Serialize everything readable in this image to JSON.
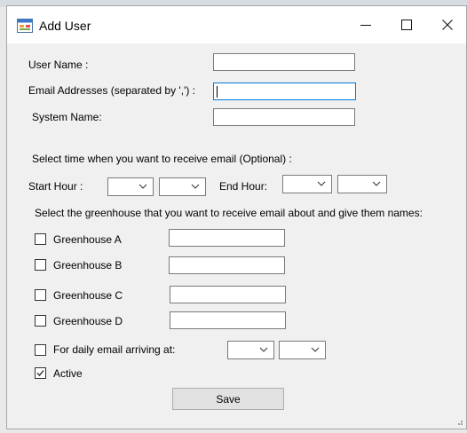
{
  "window": {
    "title": "Add User",
    "minimize_glyph": "—",
    "maximize_glyph": "☐",
    "close_glyph": "✕"
  },
  "form": {
    "user_name_label": "User Name :",
    "user_name_value": "",
    "email_label": "Email Addresses (separated by ',') :",
    "email_value": "",
    "system_name_label": "System Name:",
    "system_name_value": "",
    "time_section_label": "Select time when you want to receive email (Optional) :",
    "start_hour_label": "Start Hour :",
    "end_hour_label": "End Hour:",
    "greenhouse_section_label": "Select the greenhouse that you want to receive email about and give them names:",
    "greenhouses": [
      {
        "label": "Greenhouse A",
        "checked": false,
        "name_value": ""
      },
      {
        "label": "Greenhouse B",
        "checked": false,
        "name_value": ""
      },
      {
        "label": "Greenhouse C",
        "checked": false,
        "name_value": ""
      },
      {
        "label": "Greenhouse D",
        "checked": false,
        "name_value": ""
      }
    ],
    "daily_email_label": "For daily email arriving at:",
    "daily_email_checked": false,
    "active_label": "Active",
    "active_checked": true,
    "save_label": "Save"
  },
  "icons": {
    "app": "form-app-icon",
    "dropdown": "chevron-down-icon",
    "check": "checkmark-icon"
  },
  "colors": {
    "window_bg": "#f0f0f0",
    "focus_border": "#0078d7",
    "button_bg": "#e1e1e1"
  }
}
